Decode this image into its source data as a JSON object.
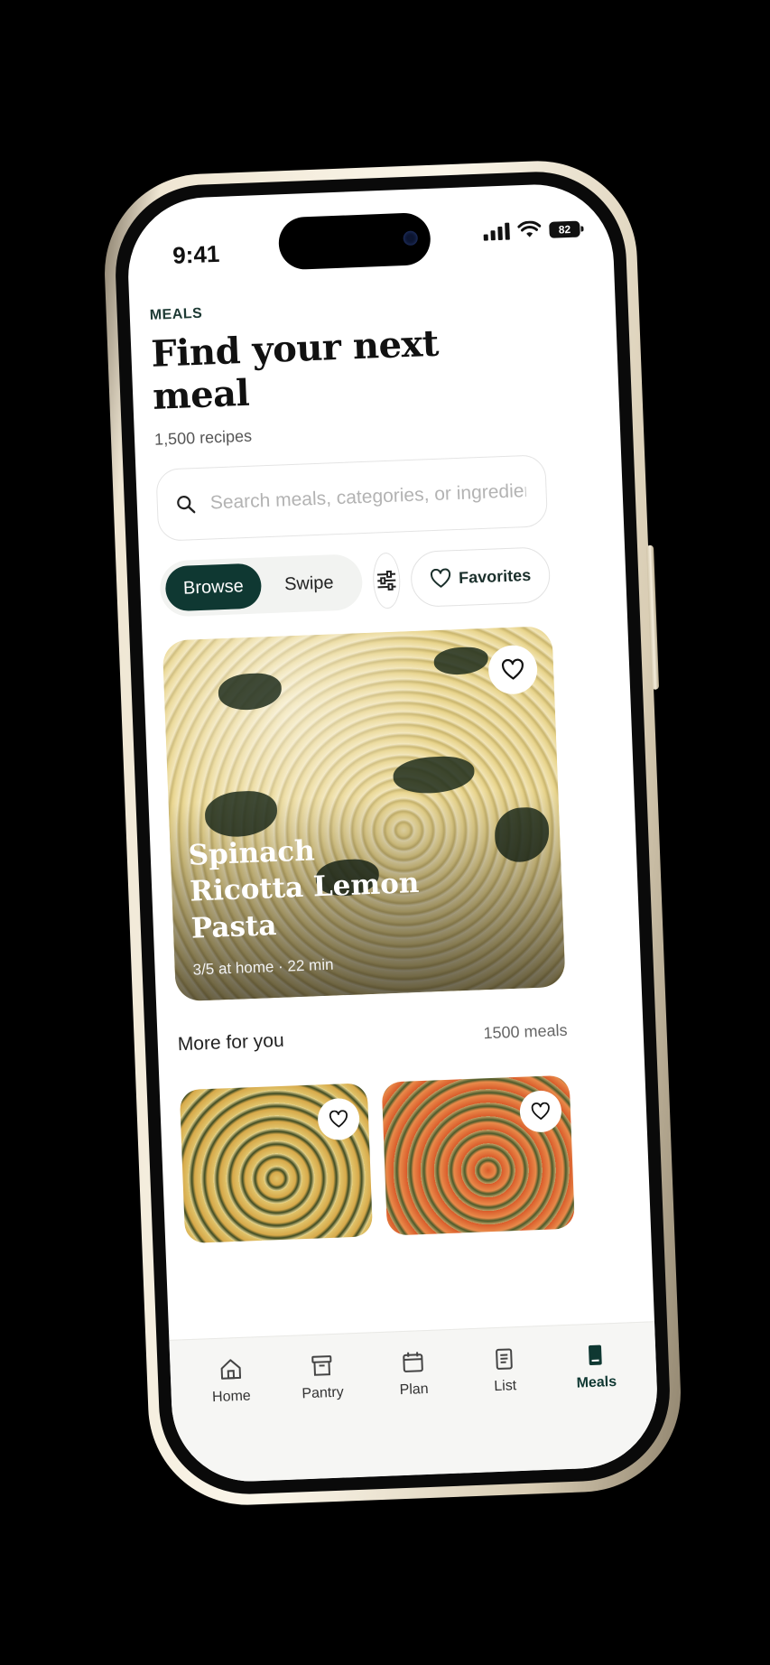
{
  "status_bar": {
    "time": "9:41",
    "battery": "82"
  },
  "header": {
    "section_label": "MEALS",
    "title": "Find your next meal",
    "subtitle": "1,500 recipes"
  },
  "search": {
    "placeholder": "Search meals, categories, or ingredients",
    "value": ""
  },
  "view_toggle": {
    "options": [
      "Browse",
      "Swipe"
    ],
    "selected": "Browse"
  },
  "favorites_label": "Favorites",
  "featured": {
    "title": "Spinach Ricotta Lemon Pasta",
    "meta": "3/5 at home · 22 min"
  },
  "more_section": {
    "title": "More for you",
    "count": "1500 meals"
  },
  "tabs": [
    {
      "label": "Home",
      "icon": "home-icon"
    },
    {
      "label": "Pantry",
      "icon": "pantry-icon"
    },
    {
      "label": "Plan",
      "icon": "calendar-icon"
    },
    {
      "label": "List",
      "icon": "list-icon"
    },
    {
      "label": "Meals",
      "icon": "meals-icon",
      "active": true
    }
  ],
  "colors": {
    "accent": "#0f3832",
    "frame": "#efe6d3"
  }
}
